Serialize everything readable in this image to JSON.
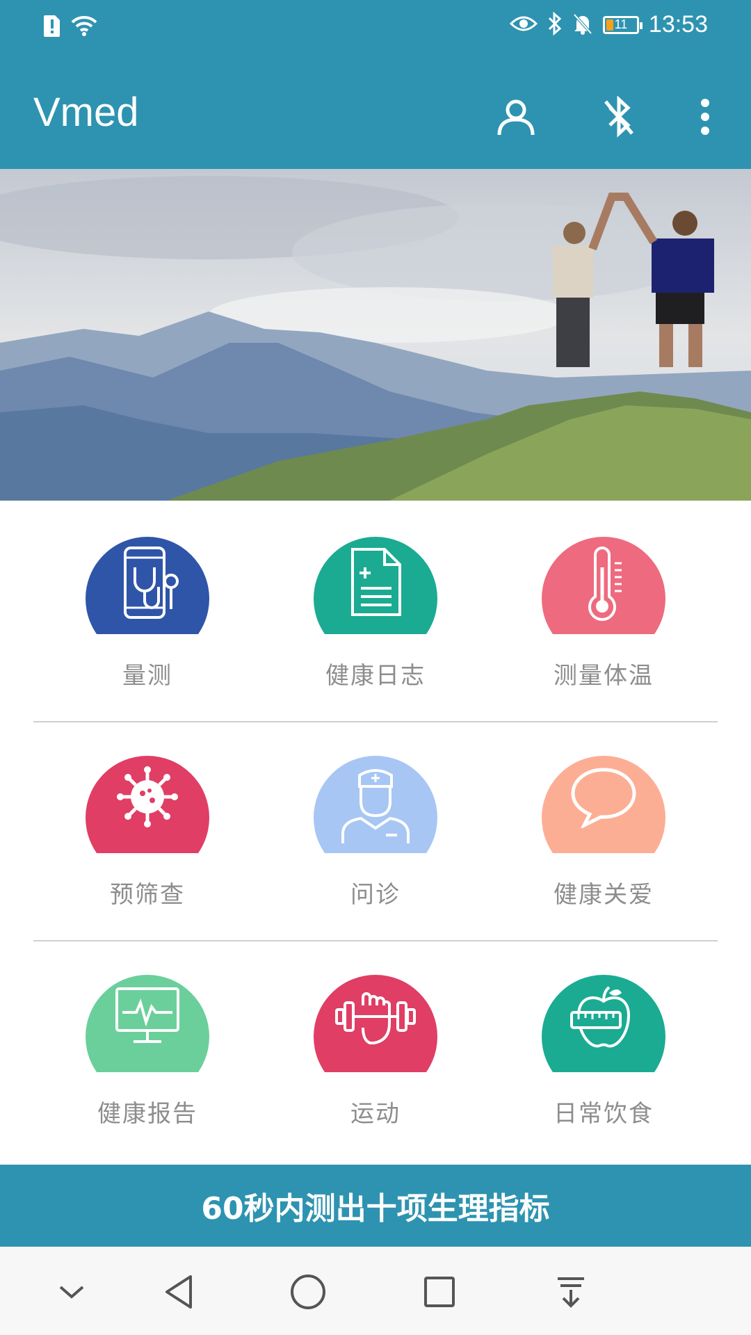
{
  "status_bar": {
    "time": "13:53",
    "battery_level": "11",
    "icons": [
      "alert-sim-icon",
      "wifi-icon",
      "eye-icon",
      "bluetooth-icon",
      "mute-bell-icon",
      "battery-icon"
    ]
  },
  "app_bar": {
    "title": "Vmed",
    "actions": [
      "profile-icon",
      "bluetooth-off-icon",
      "more-vert-icon"
    ]
  },
  "banner": {
    "description": "",
    "image": "mountain-couple-photo"
  },
  "menu": [
    {
      "label": "量测",
      "icon": "phone-stethoscope-icon",
      "color": "#2f55a8"
    },
    {
      "label": "健康日志",
      "icon": "document-icon",
      "color": "#1bab92"
    },
    {
      "label": "测量体温",
      "icon": "thermometer-icon",
      "color": "#ee6a7e"
    },
    {
      "label": "预筛查",
      "icon": "virus-icon",
      "color": "#e03e64"
    },
    {
      "label": "问诊",
      "icon": "doctor-icon",
      "color": "#a7c6f4"
    },
    {
      "label": "健康关爱",
      "icon": "chat-bubble-icon",
      "color": "#fcae94"
    },
    {
      "label": "健康报告",
      "icon": "monitor-pulse-icon",
      "color": "#6bcf9b"
    },
    {
      "label": "运动",
      "icon": "dumbbell-icon",
      "color": "#e03e64"
    },
    {
      "label": "日常饮食",
      "icon": "apple-tape-icon",
      "color": "#1bab92"
    }
  ],
  "cta": {
    "label": "60秒内测出十项生理指标"
  },
  "nav_bar": {
    "buttons": [
      "collapse-icon",
      "back-icon",
      "home-icon",
      "recents-icon",
      "notifications-pull-icon"
    ]
  },
  "colors": {
    "primary": "#2e93b0",
    "label_text": "#8d8d8d",
    "divider": "#cfcfcf"
  }
}
